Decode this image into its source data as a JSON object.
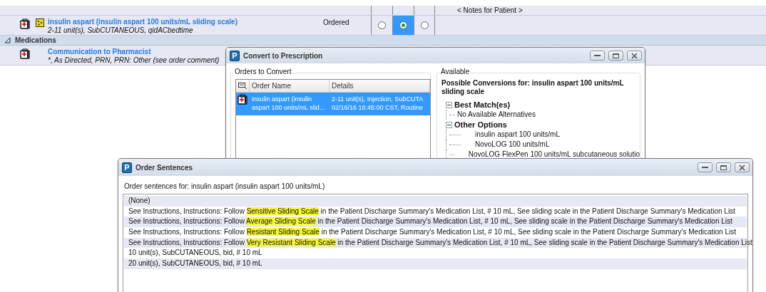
{
  "notes_header": "< Notes for Patient >",
  "order_row": {
    "name": "insulin aspart (insulin aspart 100 units/mL sliding scale)",
    "details": "2-11 unit(s), SubCUTANEOUS, qidACbedtime",
    "status": "Ordered",
    "radios": [
      {
        "selected": false
      },
      {
        "selected": true
      },
      {
        "selected": false
      }
    ]
  },
  "section": {
    "label": "Medications",
    "expanded": true
  },
  "med_row": {
    "name": "Communication to Pharmacist",
    "details": "*, As Directed, PRN, PRN: Other (see order comment)"
  },
  "convert_window": {
    "app_letter": "P",
    "title": "Convert to Prescription",
    "orders_group": "Orders to Convert",
    "columns": [
      "Order Name",
      "Details"
    ],
    "rows": [
      {
        "selected": true,
        "name_lines": [
          "insulin aspart (insulin",
          "aspart 100 units/mL slid…"
        ],
        "detail_lines": [
          "2-11 unit(s), Injection, SubCUTA",
          "02/16/16 16:45:00 CST, Routine"
        ]
      }
    ],
    "available_group": "Available",
    "heading": "Possible Conversions for: insulin aspart 100 units/mL sliding scale",
    "tree": [
      {
        "label": "Best Match(es)",
        "expanded": true,
        "children": [
          {
            "label": "No Available Alternatives"
          }
        ]
      },
      {
        "label": "Other Options",
        "expanded": true,
        "children": [
          {
            "label": "insulin aspart 100 units/mL"
          },
          {
            "label": "NovoLOG 100 units/mL"
          },
          {
            "label": "NovoLOG FlexPen 100 units/mL subcutaneous solutio"
          }
        ]
      }
    ]
  },
  "sentences_window": {
    "app_letter": "P",
    "title": "Order Sentences",
    "caption": "Order sentences for:  insulin aspart (insulin aspart 100 units/mL)",
    "rows": [
      {
        "segments": [
          {
            "text": "(None)",
            "highlighted": false
          }
        ]
      },
      {
        "segments": [
          {
            "text": "See Instructions, Instructions: Follow ",
            "highlighted": false
          },
          {
            "text": "Sensitive Sliding Scale",
            "highlighted": true
          },
          {
            "text": " in the Patient Discharge Summary's Medication List, # 10 mL, See sliding scale in the Patient Discharge Summary's Medication List",
            "highlighted": false
          }
        ]
      },
      {
        "segments": [
          {
            "text": "See Instructions, Instructions: Follow ",
            "highlighted": false
          },
          {
            "text": "Average Sliding Scale",
            "highlighted": true
          },
          {
            "text": " in the Patient Discharge Summary's Medication List, # 10 mL, See sliding scale in the Patient Discharge Summary's Medication List",
            "highlighted": false
          }
        ]
      },
      {
        "segments": [
          {
            "text": "See Instructions, Instructions: Follow ",
            "highlighted": false
          },
          {
            "text": "Resistant Sliding Scale",
            "highlighted": true
          },
          {
            "text": " in the Patient Discharge Summary's Medication List, # 10 mL, See sliding scale in the Patient Discharge Summary's Medication List",
            "highlighted": false
          }
        ]
      },
      {
        "segments": [
          {
            "text": "See Instructions, Instructions: Follow ",
            "highlighted": false
          },
          {
            "text": "Very Resistant Sliding Scale",
            "highlighted": true
          },
          {
            "text": " in the Patient Discharge Summary's Medication List, # 10 mL, See sliding scale in the Patient Discharge Summary's Medication List",
            "highlighted": false
          }
        ]
      },
      {
        "segments": [
          {
            "text": "10 unit(s), SubCUTANEOUS, bid, # 10 mL",
            "highlighted": false
          }
        ]
      },
      {
        "segments": [
          {
            "text": "20 unit(s), SubCUTANEOUS, bid, # 10 mL",
            "highlighted": false
          }
        ]
      }
    ]
  }
}
